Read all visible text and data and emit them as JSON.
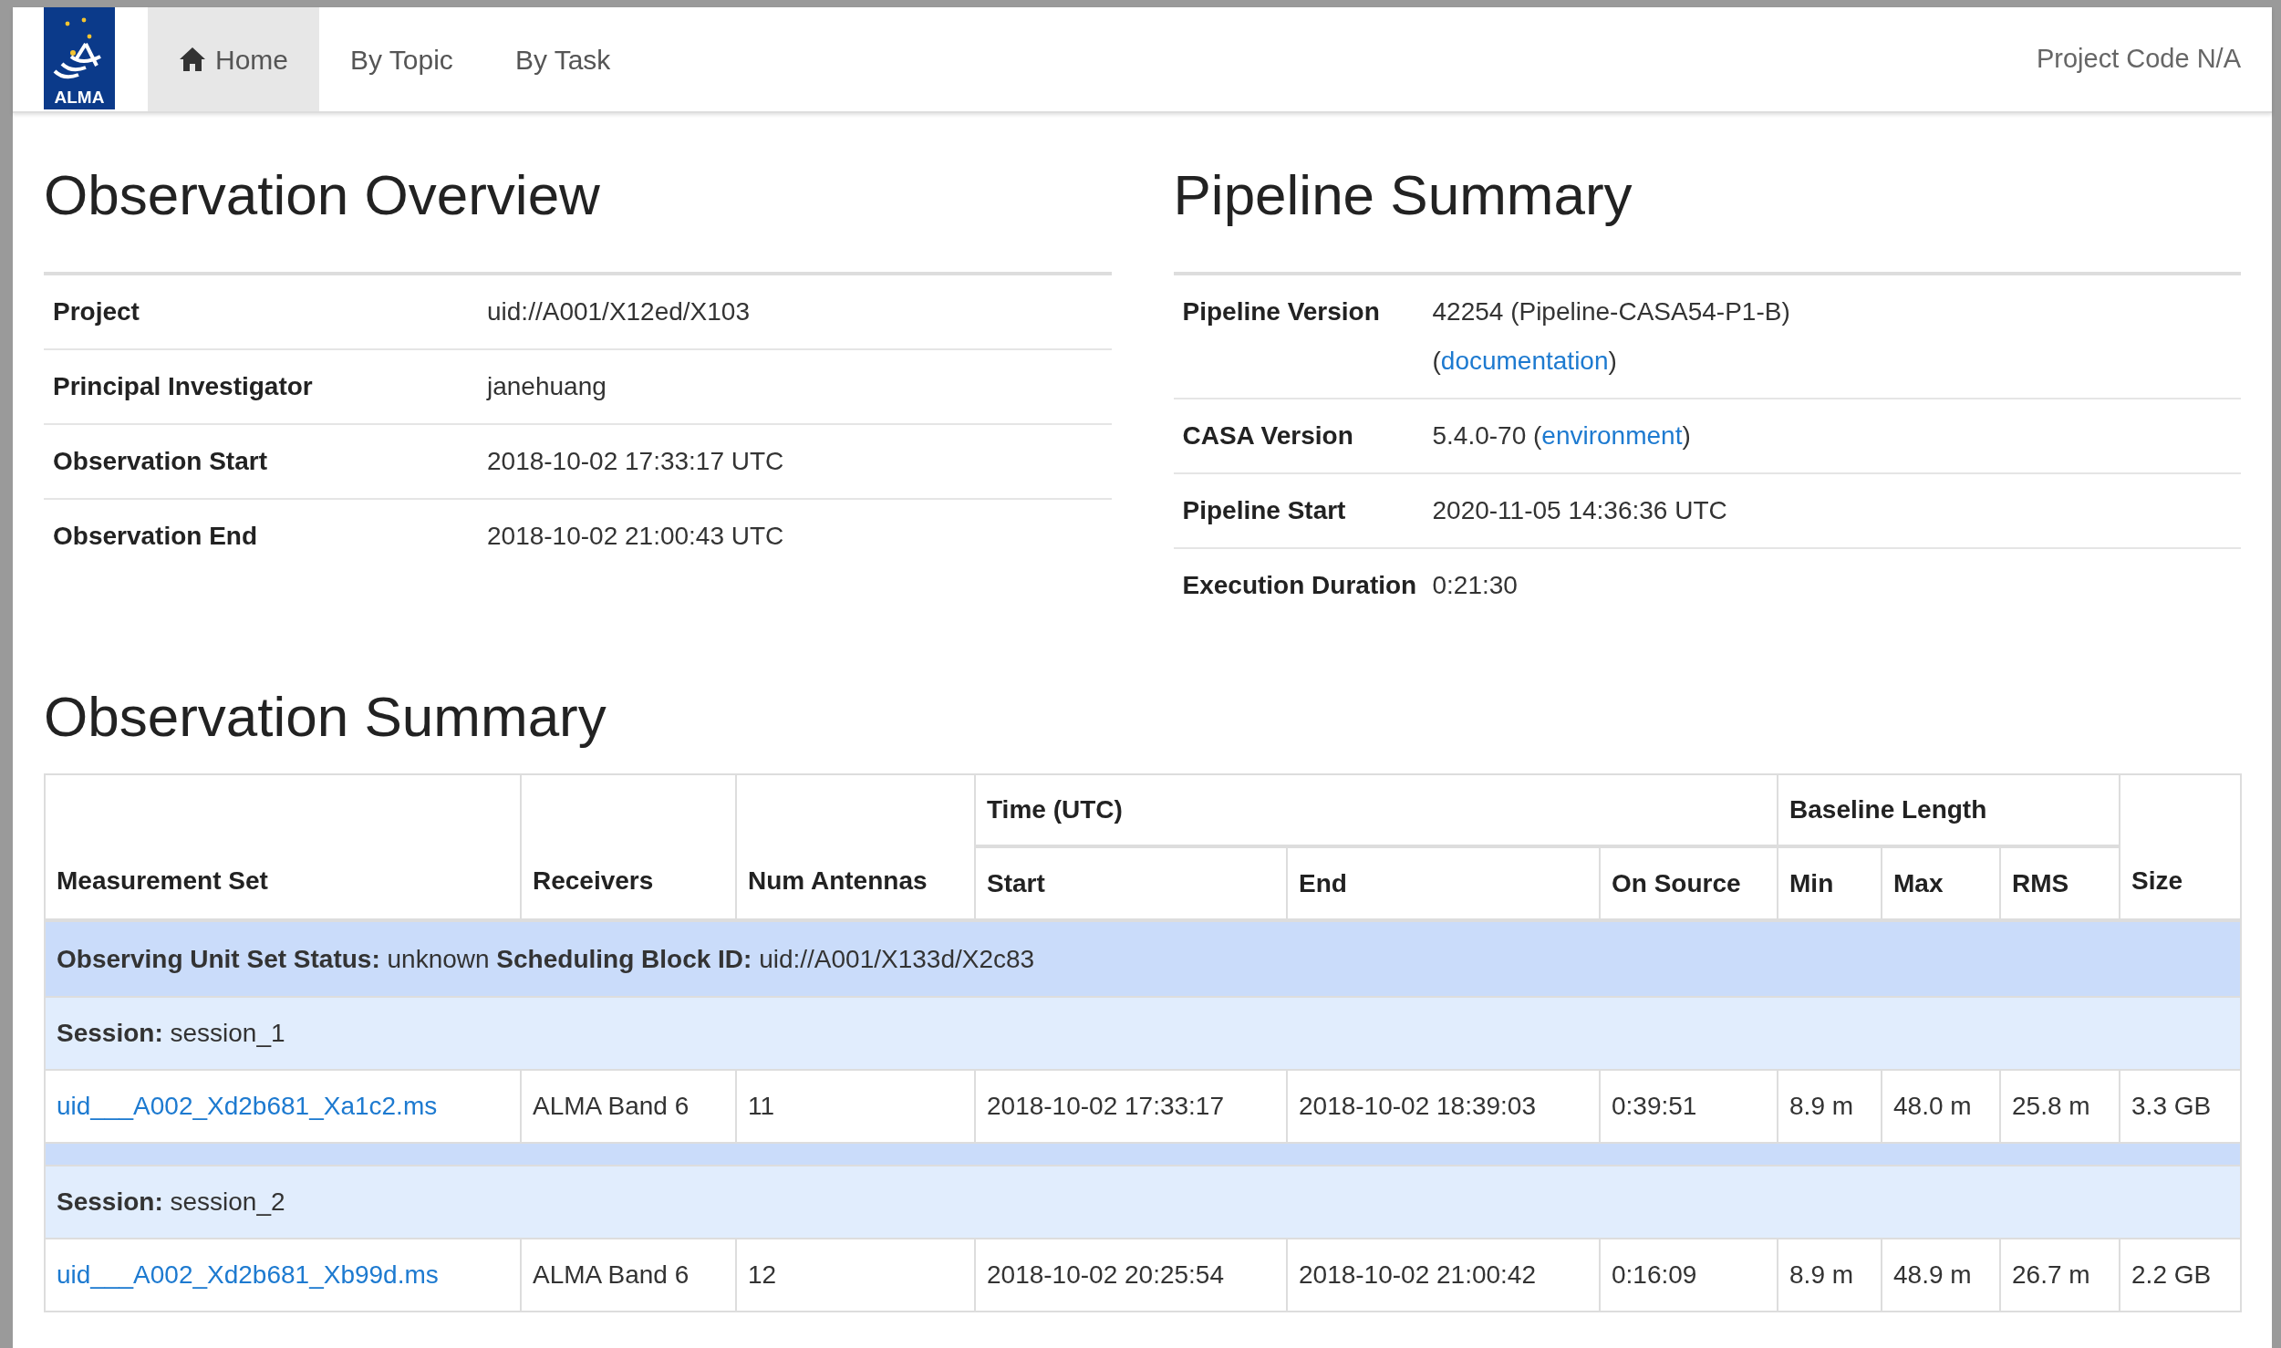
{
  "nav": {
    "logo_text": "ALMA",
    "tabs": [
      {
        "label": "Home",
        "selected": true
      },
      {
        "label": "By Topic",
        "selected": false
      },
      {
        "label": "By Task",
        "selected": false
      }
    ],
    "project_code": "Project Code N/A"
  },
  "overview": {
    "title": "Observation Overview",
    "rows": [
      {
        "label": "Project",
        "lines": [
          [
            {
              "kind": "text",
              "text": "uid://A001/X12ed/X103"
            }
          ]
        ]
      },
      {
        "label": "Principal Investigator",
        "lines": [
          [
            {
              "kind": "text",
              "text": "janehuang"
            }
          ]
        ]
      },
      {
        "label": "Observation Start",
        "lines": [
          [
            {
              "kind": "text",
              "text": "2018-10-02 17:33:17 UTC"
            }
          ]
        ]
      },
      {
        "label": "Observation End",
        "lines": [
          [
            {
              "kind": "text",
              "text": "2018-10-02 21:00:43 UTC"
            }
          ]
        ]
      }
    ]
  },
  "pipeline": {
    "title": "Pipeline Summary",
    "rows": [
      {
        "label": "Pipeline Version",
        "lines": [
          [
            {
              "kind": "text",
              "text": "42254 (Pipeline-CASA54-P1-B)"
            }
          ],
          [
            {
              "kind": "text",
              "text": "("
            },
            {
              "kind": "link",
              "text": "documentation"
            },
            {
              "kind": "text",
              "text": ")"
            }
          ]
        ]
      },
      {
        "label": "CASA Version",
        "lines": [
          [
            {
              "kind": "text",
              "text": "5.4.0-70 ("
            },
            {
              "kind": "link",
              "text": "environment"
            },
            {
              "kind": "text",
              "text": ")"
            }
          ]
        ]
      },
      {
        "label": "Pipeline Start",
        "lines": [
          [
            {
              "kind": "text",
              "text": "2020-11-05 14:36:36 UTC"
            }
          ]
        ]
      },
      {
        "label": "Execution Duration",
        "lines": [
          [
            {
              "kind": "text",
              "text": "0:21:30"
            }
          ]
        ]
      }
    ]
  },
  "summary": {
    "title": "Observation Summary",
    "columns": [
      {
        "label": "Measurement Set"
      },
      {
        "label": "Receivers"
      },
      {
        "label": "Num Antennas"
      },
      {
        "label": "Time (UTC)",
        "children": [
          "Start",
          "End",
          "On Source"
        ]
      },
      {
        "label": "Baseline Length",
        "children": [
          "Min",
          "Max",
          "RMS"
        ]
      },
      {
        "label": "Size"
      }
    ],
    "ous": "**Observing Unit Set Status:** unknown **Scheduling Block ID:** uid://A001/X133d/X2c83",
    "sessions": [
      {
        "label": "**Session:** session_1",
        "rows": [
          [
            "uid___A002_Xd2b681_Xa1c2.ms",
            "ALMA Band 6",
            "11",
            "2018-10-02 17:33:17",
            "2018-10-02 18:39:03",
            "0:39:51",
            "8.9 m",
            "48.0 m",
            "25.8 m",
            "3.3 GB"
          ]
        ]
      },
      {
        "label": "**Session:** session_2",
        "rows": [
          [
            "uid___A002_Xd2b681_Xb99d.ms",
            "ALMA Band 6",
            "12",
            "2018-10-02 20:25:54",
            "2018-10-02 21:00:42",
            "0:16:09",
            "8.9 m",
            "48.9 m",
            "26.7 m",
            "2.2 GB"
          ]
        ]
      }
    ]
  }
}
